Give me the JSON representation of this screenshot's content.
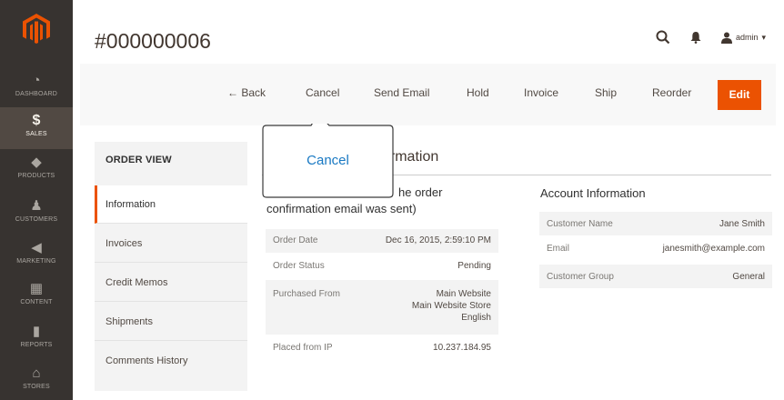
{
  "nav": {
    "items": [
      {
        "label": "DASHBOARD",
        "icon": "speedometer-icon",
        "glyph": "◔"
      },
      {
        "label": "SALES",
        "icon": "dollar-icon",
        "glyph": "$"
      },
      {
        "label": "PRODUCTS",
        "icon": "cube-icon",
        "glyph": "◆"
      },
      {
        "label": "CUSTOMERS",
        "icon": "person-icon",
        "glyph": "♟"
      },
      {
        "label": "MARKETING",
        "icon": "megaphone-icon",
        "glyph": "◀"
      },
      {
        "label": "CONTENT",
        "icon": "layout-icon",
        "glyph": "▦"
      },
      {
        "label": "REPORTS",
        "icon": "bar-chart-icon",
        "glyph": "▮"
      },
      {
        "label": "STORES",
        "icon": "store-icon",
        "glyph": "⌂"
      }
    ]
  },
  "header": {
    "title": "#000000006",
    "user": "admin",
    "user_caret": "▾"
  },
  "actions": {
    "back": "← Back",
    "cancel": "Cancel",
    "send_email": "Send Email",
    "hold": "Hold",
    "invoice": "Invoice",
    "ship": "Ship",
    "reorder": "Reorder",
    "edit": "Edit"
  },
  "tooltip": {
    "text": "Cancel"
  },
  "sidebar": {
    "title": "ORDER VIEW",
    "tabs": [
      "Information",
      "Invoices",
      "Credit Memos",
      "Shipments",
      "Comments History"
    ]
  },
  "main": {
    "section_title_fragment": "ormation",
    "order_title_l1_fragment": "he order",
    "order_title_l2": "confirmation email was sent)",
    "order_rows": [
      {
        "k": "Order Date",
        "v": "Dec 16, 2015, 2:59:10 PM"
      },
      {
        "k": "Order Status",
        "v": "Pending"
      },
      {
        "k": "Purchased From",
        "v1": "Main Website",
        "v2": "Main Website Store",
        "v3": "English"
      },
      {
        "k": "Placed from IP",
        "v": "10.237.184.95"
      }
    ],
    "account_title": "Account Information",
    "account_rows": [
      {
        "k": "Customer Name",
        "v": "Jane Smith"
      },
      {
        "k": "Email",
        "v": "janesmith@example.com"
      },
      {
        "k": "Customer Group",
        "v": "General"
      }
    ]
  },
  "colors": {
    "accent": "#eb5202",
    "link": "#1979c3",
    "nav_bg": "#373330"
  }
}
